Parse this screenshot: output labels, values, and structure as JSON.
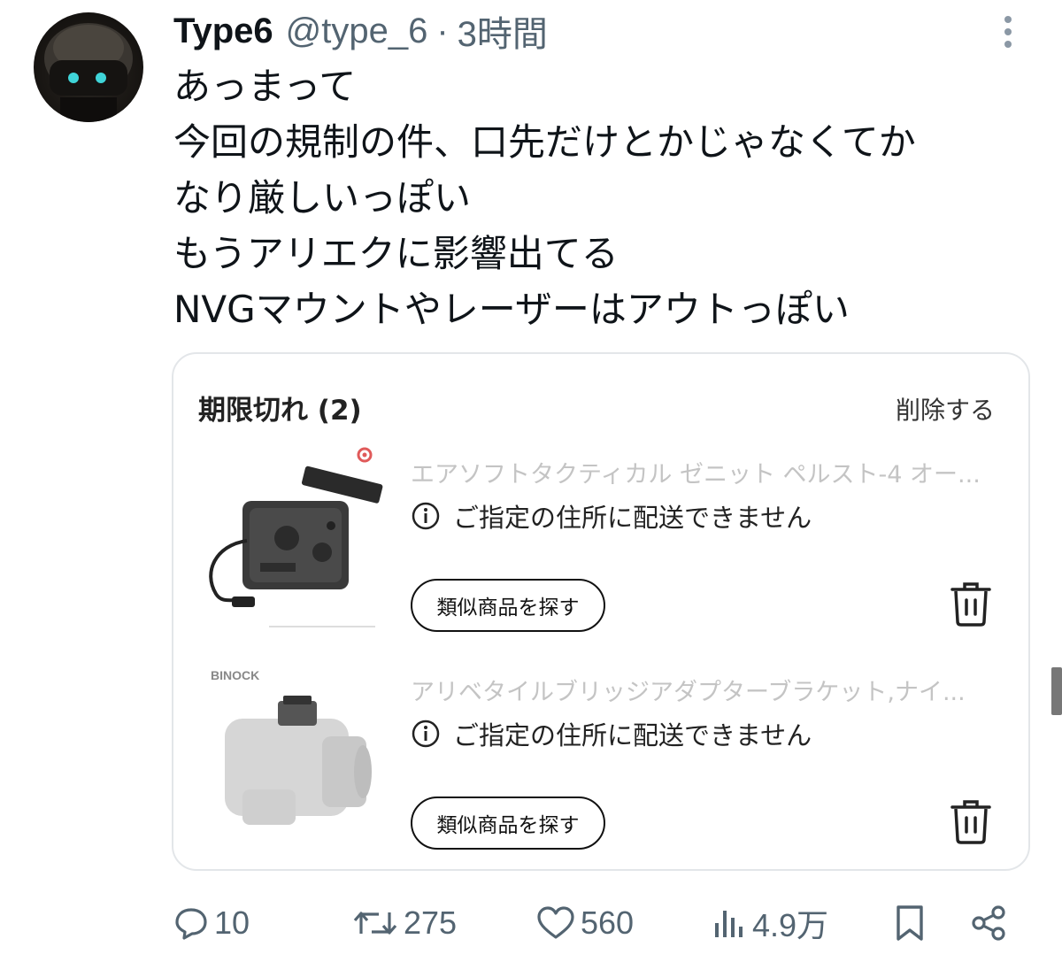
{
  "tweet": {
    "author_name": "Type6",
    "handle": "@type_6",
    "separator": "·",
    "time": "3時間",
    "text_lines": [
      "あっまって",
      "今回の規制の件、口先だけとかじゃなくてか",
      "なり厳しいっぽい",
      "もうアリエクに影響出てる",
      "NVGマウントやレーザーはアウトっぽい"
    ]
  },
  "media_card": {
    "title": "期限切れ (2)",
    "delete_label": "削除する",
    "items": [
      {
        "title": "エアソフトタクティカル ゼニット ペルスト-4 オー...",
        "notice": "ご指定の住所に配送できません",
        "button": "類似商品を探す"
      },
      {
        "brand": "BINOCK",
        "title": "アリベタイルブリッジアダプターブラケット,ナイ...",
        "notice": "ご指定の住所に配送できません",
        "button": "類似商品を探す"
      }
    ]
  },
  "actions": {
    "replies": "10",
    "retweets": "275",
    "likes": "560",
    "views": "4.9万"
  },
  "colors": {
    "text": "#0f1419",
    "secondary": "#536471",
    "card_border": "#e3e6e9",
    "grey_title": "#c4c4c4"
  },
  "icons": [
    "more-vertical-icon",
    "info-icon",
    "trash-icon",
    "reply-icon",
    "retweet-icon",
    "like-icon",
    "views-icon",
    "bookmark-icon",
    "share-icon"
  ]
}
